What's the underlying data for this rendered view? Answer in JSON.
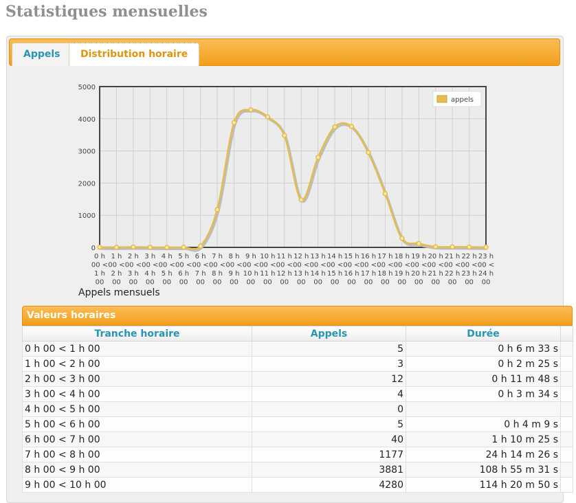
{
  "page": {
    "title": "Statistiques mensuelles"
  },
  "tabs": [
    {
      "label": "Appels",
      "active": false
    },
    {
      "label": "Distribution horaire",
      "active": true
    }
  ],
  "colors": {
    "accent": "#f19e1b",
    "link": "#2a95b0",
    "series": "#e4bd4e"
  },
  "chart_data": {
    "type": "line",
    "caption": "Appels mensuels",
    "categories": [
      [
        "0 h",
        "00 <",
        "1 h",
        "00"
      ],
      [
        "1 h",
        "00 <",
        "2 h",
        "00"
      ],
      [
        "2 h",
        "00 <",
        "3 h",
        "00"
      ],
      [
        "3 h",
        "00 <",
        "4 h",
        "00"
      ],
      [
        "4 h",
        "00 <",
        "5 h",
        "00"
      ],
      [
        "5 h",
        "00 <",
        "6 h",
        "00"
      ],
      [
        "6 h",
        "00 <",
        "7 h",
        "00"
      ],
      [
        "7 h",
        "00 <",
        "8 h",
        "00"
      ],
      [
        "8 h",
        "00 <",
        "9 h",
        "00"
      ],
      [
        "9 h",
        "00 <",
        "10 h",
        "00"
      ],
      [
        "10 h",
        "00 <",
        "11 h",
        "00"
      ],
      [
        "11 h",
        "00 <",
        "12 h",
        "00"
      ],
      [
        "12 h",
        "00 <",
        "13 h",
        "00"
      ],
      [
        "13 h",
        "00 <",
        "14 h",
        "00"
      ],
      [
        "14 h",
        "00 <",
        "15 h",
        "00"
      ],
      [
        "15 h",
        "00 <",
        "16 h",
        "00"
      ],
      [
        "16 h",
        "00 <",
        "17 h",
        "00"
      ],
      [
        "17 h",
        "00 <",
        "18 h",
        "00"
      ],
      [
        "18 h",
        "00 <",
        "19 h",
        "00"
      ],
      [
        "19 h",
        "00 <",
        "20 h",
        "00"
      ],
      [
        "20 h",
        "00 <",
        "21 h",
        "00"
      ],
      [
        "21 h",
        "00 <",
        "22 h",
        "00"
      ],
      [
        "22 h",
        "00 <",
        "23 h",
        "00"
      ],
      [
        "23 h",
        "00 <",
        "24 h",
        "00"
      ]
    ],
    "series": [
      {
        "name": "appels",
        "values": [
          5,
          3,
          12,
          4,
          0,
          5,
          40,
          1177,
          3881,
          4280,
          4060,
          3480,
          1480,
          2800,
          3750,
          3760,
          2950,
          1670,
          280,
          120,
          20,
          15,
          10,
          5
        ]
      }
    ],
    "ylim": [
      0,
      5000
    ],
    "yticks": [
      0,
      1000,
      2000,
      3000,
      4000,
      5000
    ],
    "grid": true,
    "legend": "top-right"
  },
  "table": {
    "title": "Valeurs horaires",
    "columns": [
      "Tranche horaire",
      "Appels",
      "Durée"
    ],
    "rows": [
      [
        "0 h 00 < 1 h 00",
        "5",
        "0 h 6 m 33 s"
      ],
      [
        "1 h 00 < 2 h 00",
        "3",
        "0 h 2 m 25 s"
      ],
      [
        "2 h 00 < 3 h 00",
        "12",
        "0 h 11 m 48 s"
      ],
      [
        "3 h 00 < 4 h 00",
        "4",
        "0 h 3 m 34 s"
      ],
      [
        "4 h 00 < 5 h 00",
        "0",
        ""
      ],
      [
        "5 h 00 < 6 h 00",
        "5",
        "0 h 4 m 9 s"
      ],
      [
        "6 h 00 < 7 h 00",
        "40",
        "1 h 10 m 25 s"
      ],
      [
        "7 h 00 < 8 h 00",
        "1177",
        "24 h 14 m 26 s"
      ],
      [
        "8 h 00 < 9 h 00",
        "3881",
        "108 h 55 m 31 s"
      ],
      [
        "9 h 00 < 10 h 00",
        "4280",
        "114 h 20 m 50 s"
      ]
    ]
  }
}
